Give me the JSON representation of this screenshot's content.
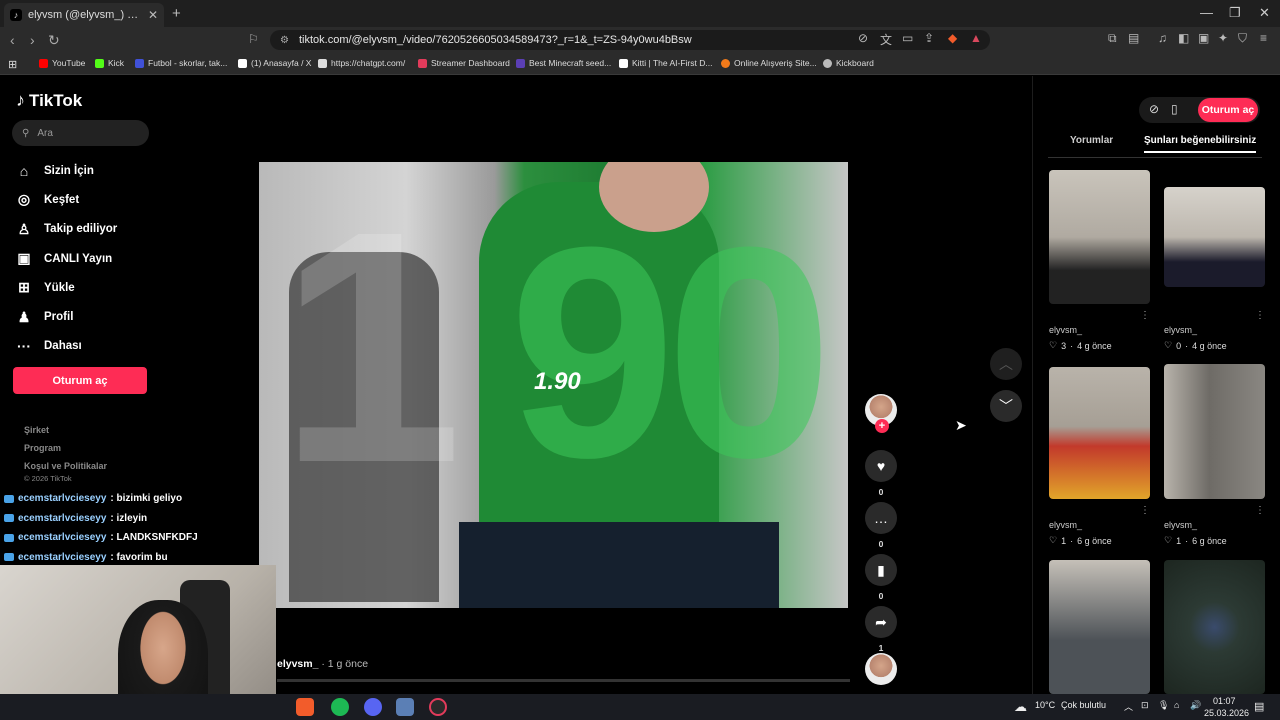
{
  "browser": {
    "tab_title": "elyvsm (@elyvsm_) adlı kullanıcı",
    "url": "tiktok.com/@elyvsm_/video/7620526605034589473?_r=1&_t=ZS-94y0wu4bBsw",
    "bookmarks": [
      {
        "label": "YouTube",
        "color": "#ff0000"
      },
      {
        "label": "Kick",
        "color": "#53fc18"
      },
      {
        "label": "Futbol - skorlar, tak...",
        "color": "#4051d8"
      },
      {
        "label": "(1) Anasayfa / X",
        "color": "#ffffff"
      },
      {
        "label": "https://chatgpt.com/",
        "color": "#dddddd"
      },
      {
        "label": "Streamer Dashboard",
        "color": "#e23b5b"
      },
      {
        "label": "Best Minecraft seed...",
        "color": "#5b3fb5"
      },
      {
        "label": "Kitti | The AI-First D...",
        "color": "#ffffff"
      },
      {
        "label": "Online Alışveriş Site...",
        "color": "#f27a1a"
      },
      {
        "label": "Kickboard",
        "color": "#bbbbbb"
      }
    ]
  },
  "tiktok": {
    "logo": "TikTok",
    "search_placeholder": "Ara",
    "menu": [
      {
        "label": "Sizin İçin",
        "icon": "home-icon",
        "glyph": "⌂"
      },
      {
        "label": "Keşfet",
        "icon": "compass-icon",
        "glyph": "◎"
      },
      {
        "label": "Takip ediliyor",
        "icon": "following-icon",
        "glyph": "♙"
      },
      {
        "label": "CANLI Yayın",
        "icon": "live-icon",
        "glyph": "▣"
      },
      {
        "label": "Yükle",
        "icon": "upload-icon",
        "glyph": "⊞"
      },
      {
        "label": "Profil",
        "icon": "profile-icon",
        "glyph": "♟"
      },
      {
        "label": "Dahası",
        "icon": "more-icon",
        "glyph": "···"
      }
    ],
    "login_label": "Oturum aç",
    "footer_links": [
      "Şirket",
      "Program",
      "Koşul ve Politikalar"
    ],
    "copyright": "© 2026 TikTok"
  },
  "chat": [
    {
      "user": "ecemstarlvcieseyy",
      "msg": ": bizimki geliyo"
    },
    {
      "user": "ecemstarlvcieseyy",
      "msg": ": izleyin"
    },
    {
      "user": "ecemstarlvcieseyy",
      "msg": ": LANDKSNFKDFJ"
    },
    {
      "user": "ecemstarlvcieseyy",
      "msg": ": favorim bu"
    }
  ],
  "video": {
    "overlay_small": "1.90",
    "overlay_big_left": "1",
    "overlay_big_right": "90",
    "author": "elyvsm_",
    "time": " · 1 g önce",
    "likes": "0",
    "comments": "0",
    "saves": "0",
    "shares": "1"
  },
  "right_panel": {
    "login_label": "Oturum aç",
    "tabs": [
      "Yorumlar",
      "Şunları beğenebilirsiniz"
    ],
    "active_tab": 1,
    "thumbs": [
      {
        "author": "elyvsm_",
        "likes": "3",
        "time": "4 g önce",
        "colors": [
          "#c9c4bb",
          "#222222"
        ]
      },
      {
        "author": "elyvsm_",
        "likes": "0",
        "time": "4 g önce",
        "colors": [
          "#d6d2cb",
          "#1b1b2b"
        ]
      },
      {
        "author": "elyvsm_",
        "likes": "1",
        "time": "6 g önce",
        "colors": [
          "#b9b3aa",
          "#c2392b"
        ]
      },
      {
        "author": "elyvsm_",
        "likes": "1",
        "time": "6 g önce",
        "colors": [
          "#b8b3ab",
          "#6e6b66"
        ]
      },
      {
        "author": "",
        "likes": "",
        "time": "",
        "colors": [
          "#c5c0b8",
          "#4d5257"
        ]
      },
      {
        "author": "",
        "likes": "",
        "time": "",
        "colors": [
          "#2c3a34",
          "#3a4b6c"
        ]
      }
    ]
  },
  "taskbar": {
    "weather": "10°C",
    "weather_desc": "Çok bulutlu",
    "time": "01:07",
    "date": "25.03.2026"
  }
}
